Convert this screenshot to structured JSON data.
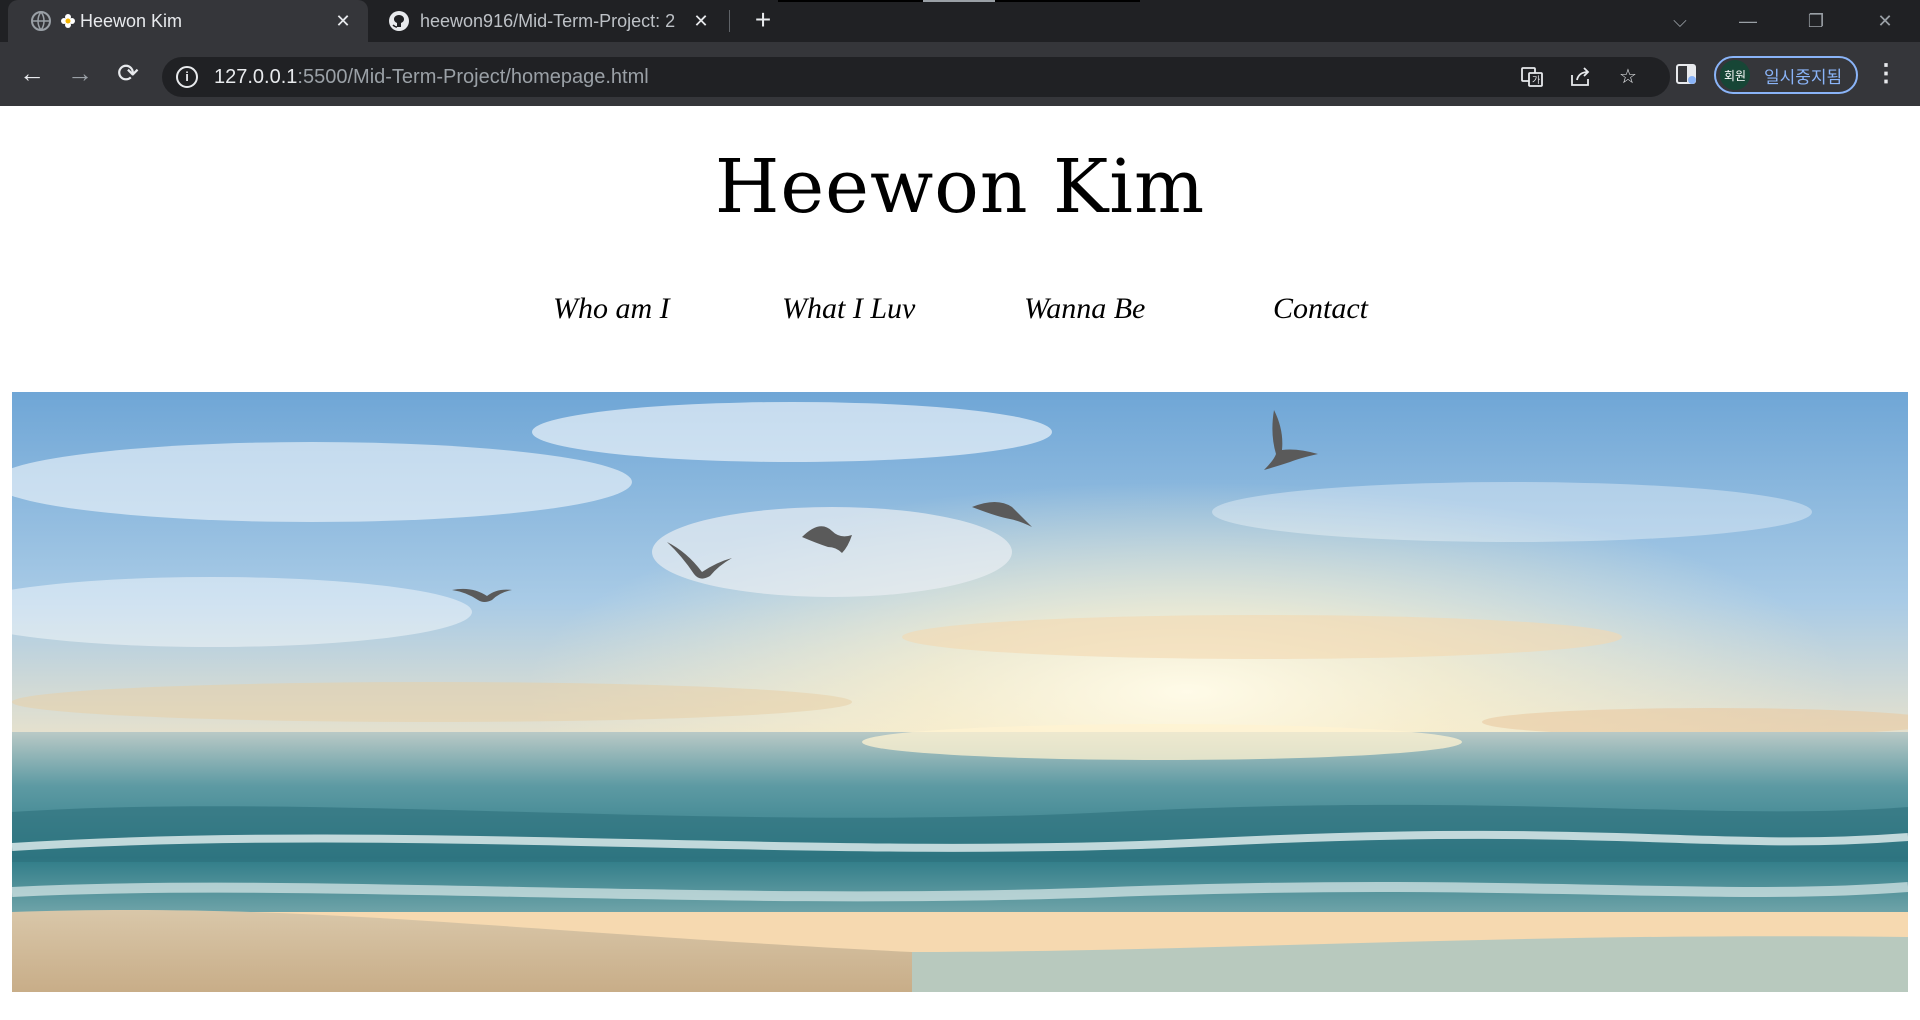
{
  "browser": {
    "tabs": [
      {
        "title": "Heewon Kim",
        "active": true,
        "favicon": "flower-favicon"
      },
      {
        "title": "heewon916/Mid-Term-Project: 2",
        "active": false,
        "favicon": "github-icon"
      }
    ],
    "address": {
      "host": "127.0.0.1",
      "path": ":5500/Mid-Term-Project/homepage.html"
    },
    "profile": {
      "avatar_label": "회원",
      "status": "일시중지됨"
    }
  },
  "site": {
    "title": "Heewon Kim",
    "nav": [
      "Who am I",
      "What I Luv",
      "Wanna Be",
      "Contact"
    ]
  },
  "hero": {
    "scene": "ocean-sunrise-with-seagulls"
  },
  "colors": {
    "tabbar": "#202124",
    "toolbar": "#35363a",
    "profile_accent": "#8ab4f8",
    "page_background": "#ffffff"
  }
}
